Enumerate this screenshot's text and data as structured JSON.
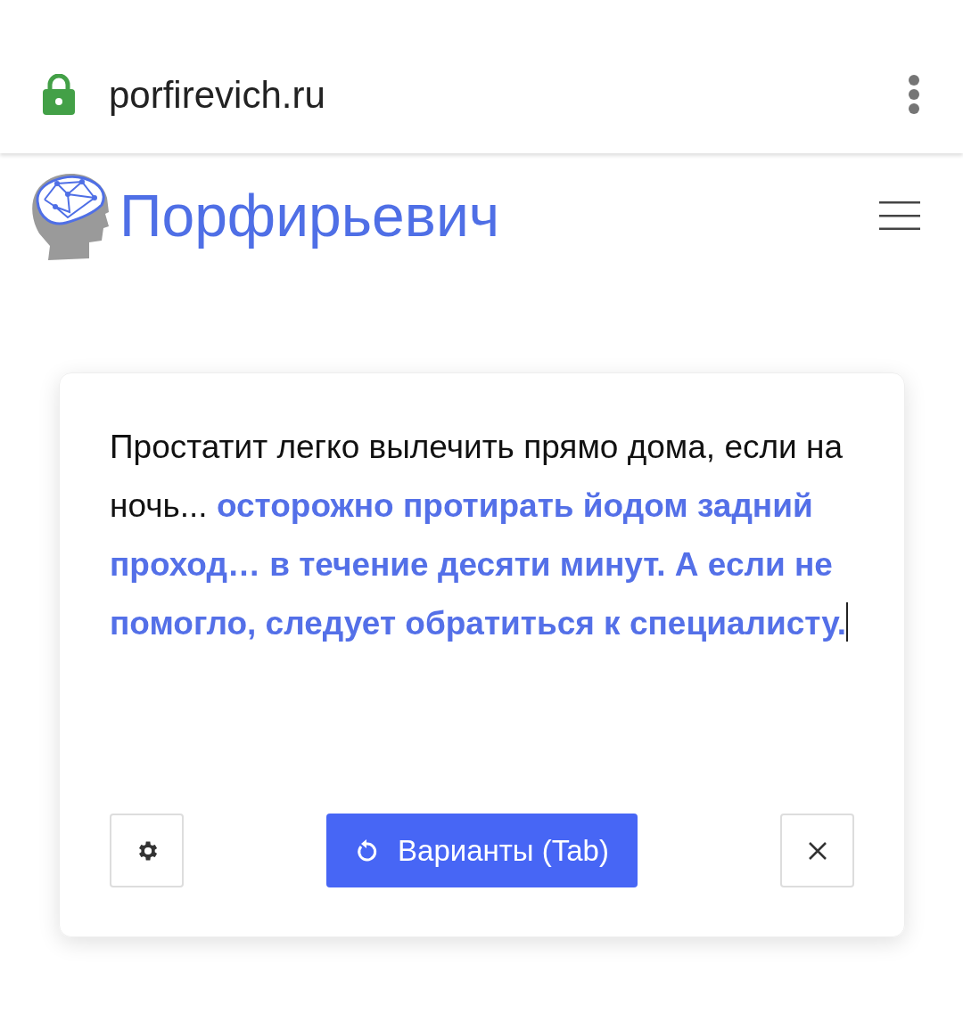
{
  "browser": {
    "url": "porfirevich.ru",
    "secure": true
  },
  "site": {
    "title": "Порфирьевич"
  },
  "editor": {
    "prompt": "Простатит легко вылечить прямо дома, если на ночь... ",
    "completion": "осторожно протирать йодом задний проход… в течение десяти минут. А если не помогло, следует обратиться к специалисту.",
    "focused": true
  },
  "buttons": [
    {
      "kind": "settings"
    },
    {
      "kind": "variants",
      "label": "Варианты (Tab)"
    },
    {
      "kind": "close"
    }
  ]
}
